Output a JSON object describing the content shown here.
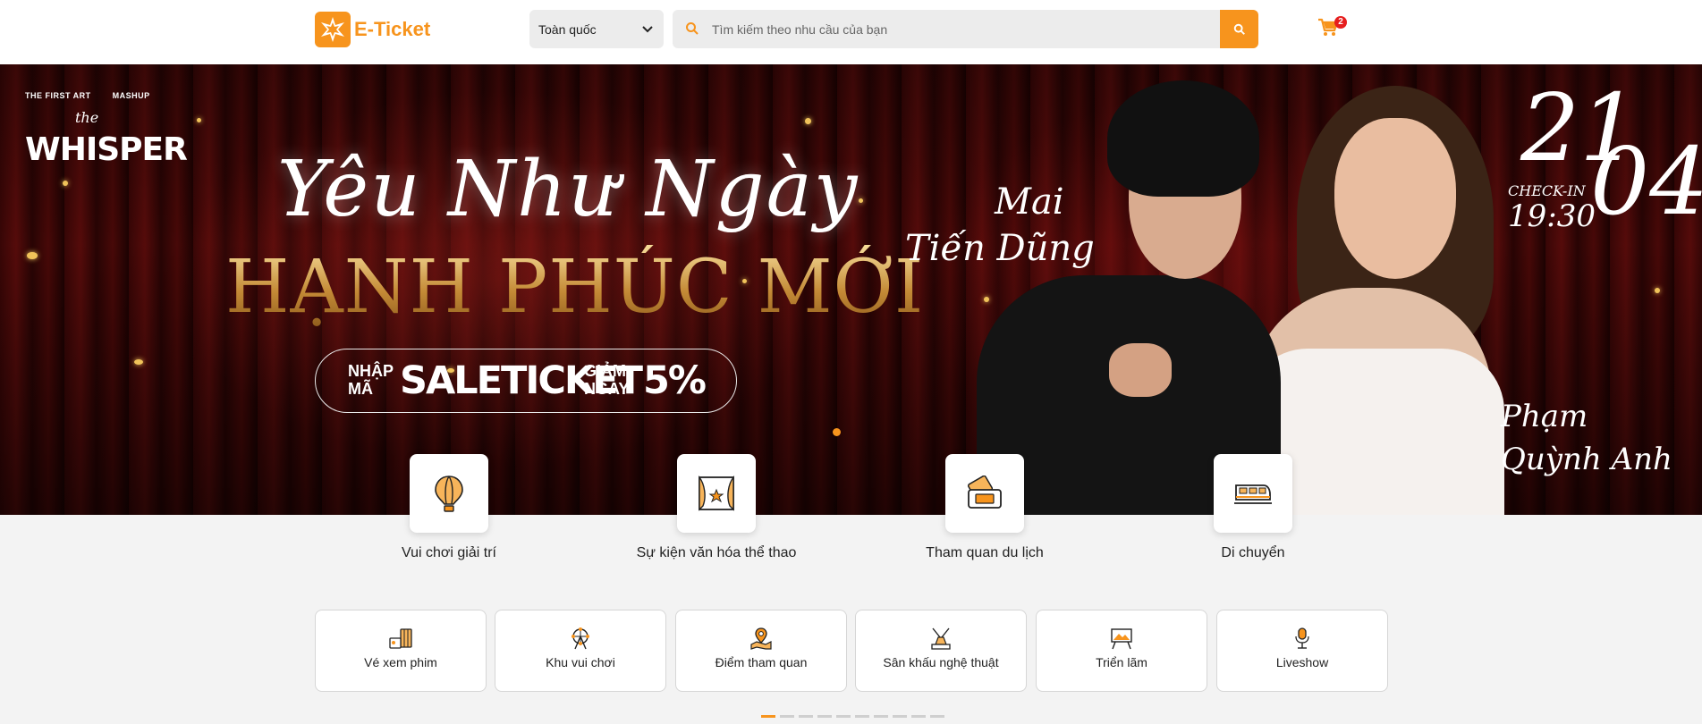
{
  "header": {
    "logo_text": "E-Ticket",
    "region_value": "Toàn quốc",
    "search_placeholder": "Tìm kiếm theo nhu cầu của bạn",
    "cart_count": "2"
  },
  "banner": {
    "brand_left_1": "THE FIRST ART",
    "brand_left_2": "MASHUP",
    "brand_the": "the",
    "brand_main": "WHISPER",
    "title_script": "Yêu Như Ngày",
    "title_main": "HẠNH PHÚC MỚI",
    "promo_prefix": "NHẬP MÃ",
    "promo_code": "SALETICKET",
    "promo_discount_label": "GIẢM NGAY",
    "promo_discount_value": "5%",
    "artist_1_line_1": "Mai",
    "artist_1_line_2": "Tiến Dũng",
    "artist_2_line_1": "Phạm",
    "artist_2_line_2": "Quỳnh Anh",
    "date_day": "21",
    "date_month": "04",
    "checkin_label": "CHECK-IN",
    "checkin_time": "19:30"
  },
  "categories": [
    {
      "label": "Vui chơi giải trí",
      "icon": "hot-air-balloon-icon"
    },
    {
      "label": "Sự kiện văn hóa thể thao",
      "icon": "stage-star-icon"
    },
    {
      "label": "Tham quan du lịch",
      "icon": "ticket-icon"
    },
    {
      "label": "Di chuyển",
      "icon": "train-icon"
    }
  ],
  "subcategories": [
    {
      "label": "Vé xem phim",
      "icon": "popcorn-icon"
    },
    {
      "label": "Khu vui chơi",
      "icon": "ferris-wheel-icon"
    },
    {
      "label": "Điểm tham quan",
      "icon": "map-pin-icon"
    },
    {
      "label": "Sân khấu nghệ thuật",
      "icon": "spotlight-stage-icon"
    },
    {
      "label": "Triển lãm",
      "icon": "exhibition-frame-icon"
    },
    {
      "label": "Liveshow",
      "icon": "microphone-icon"
    }
  ],
  "pager": {
    "count": 10,
    "active_index": 0
  },
  "colors": {
    "accent": "#f7941d",
    "badge": "#e61e1e"
  }
}
